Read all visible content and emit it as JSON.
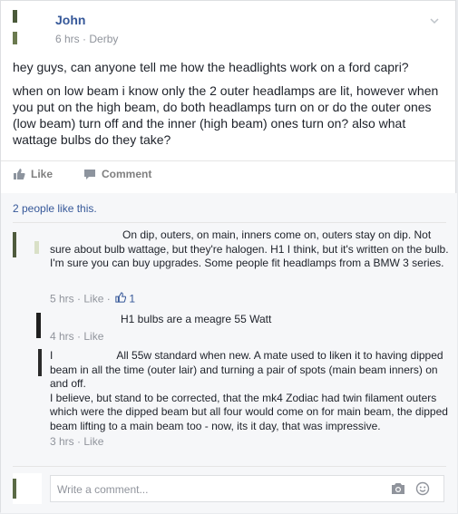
{
  "post": {
    "author": "John",
    "time": "6 hrs",
    "separator": "·",
    "location": "Derby",
    "paragraphs": [
      "hey guys, can anyone tell me how the headlights work on a ford capri?",
      "when on low beam i know only the 2 outer headlamps are lit, however when you put on the high beam, do both headlamps turn on or do the outer ones (low beam) turn off and the inner (high beam) ones turn on? also what wattage bulbs do they take?"
    ]
  },
  "actions": {
    "like_label": "Like",
    "comment_label": "Comment"
  },
  "likes_summary": "2 people like this.",
  "comments": [
    {
      "text": "On dip, outers, on main, inners come on, outers stay on dip. Not sure about bulb wattage, but they're halogen. H1 I think, but it's written on the bulb. I'm sure you can buy upgrades. Some people fit headlamps from a BMW 3 series.",
      "time": "5 hrs",
      "like": "Like",
      "like_count": "1"
    },
    {
      "text": "H1 bulbs are a meagre 55 Watt",
      "time": "4 hrs",
      "like": "Like"
    },
    {
      "name_fragment": "I",
      "text": "All 55w standard when new. A mate used to liken it to having dipped beam in all the time (outer lair) and turning a pair of spots (main beam inners) on and off.",
      "text2": "I believe, but stand to be corrected, that the mk4 Zodiac had twin filament outers which were the dipped beam but all four would come on for main beam, the dipped beam lifting to a main beam too - now, its it day, that was impressive.",
      "time": "3 hrs",
      "like": "Like"
    }
  ],
  "reply": {
    "placeholder": "Write a comment..."
  },
  "icons": {
    "chevron": "chevron-down-icon",
    "like": "thumbs-up-icon",
    "comment": "speech-bubble-icon",
    "camera": "camera-icon",
    "smile": "smile-icon"
  },
  "colors": {
    "link": "#365899",
    "muted": "#90949c",
    "text": "#1d2129"
  }
}
